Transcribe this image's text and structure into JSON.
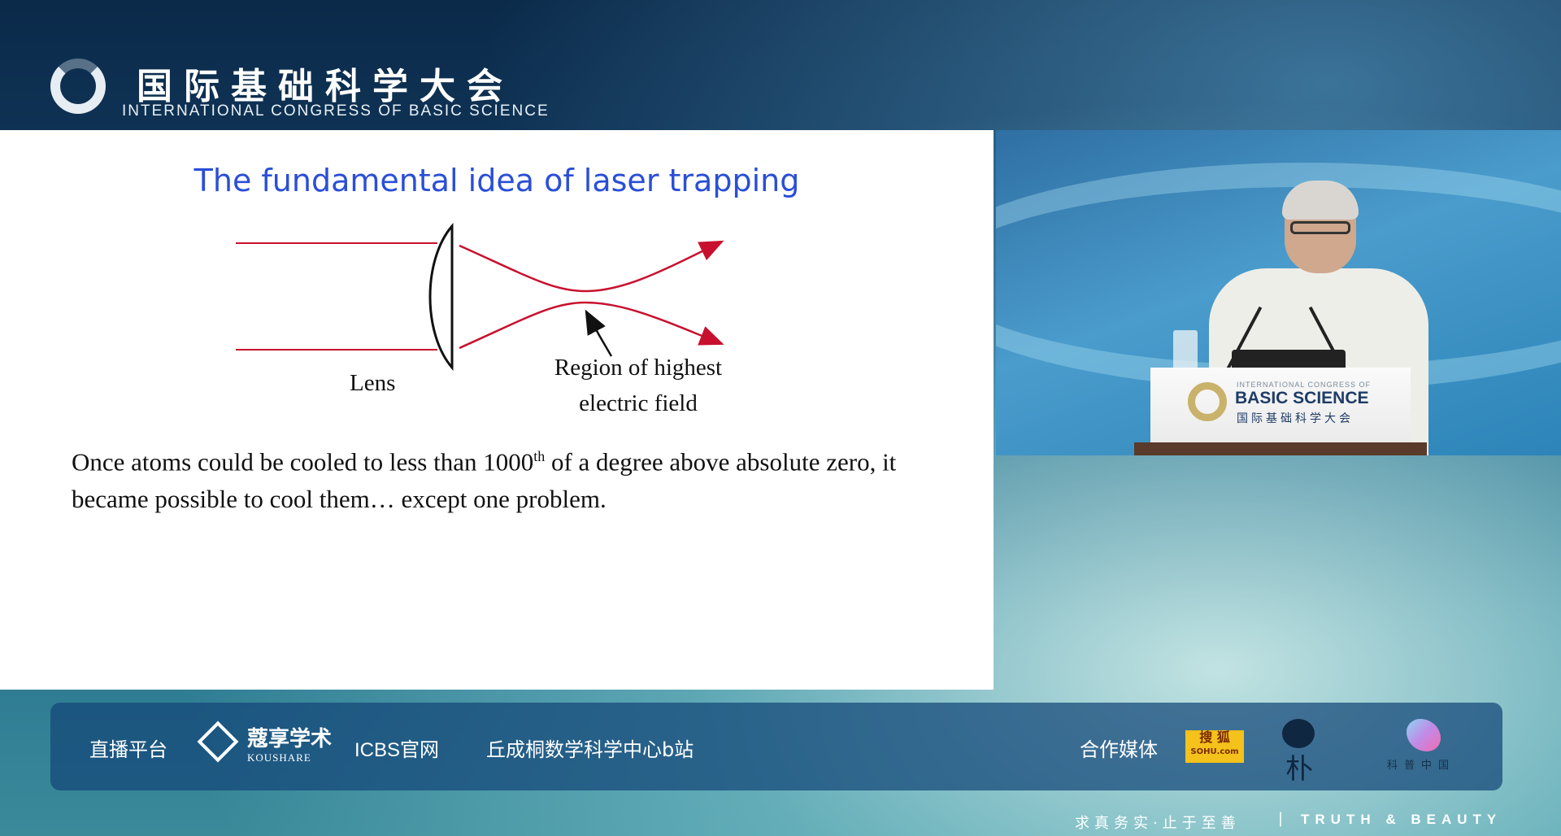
{
  "header": {
    "title_cn": "国际基础科学大会",
    "title_en": "INTERNATIONAL CONGRESS OF BASIC SCIENCE"
  },
  "slide": {
    "title": "The fundamental idea of laser trapping",
    "lens_label": "Lens",
    "region_label_line1": "Region of highest",
    "region_label_line2": "electric field",
    "body_part1": "Once atoms could be cooled to less than 1000",
    "body_sup": "th",
    "body_part2": " of a degree above absolute zero, it became possible to cool them… except one problem."
  },
  "podium": {
    "line1": "INTERNATIONAL CONGRESS OF",
    "line2": "BASIC SCIENCE",
    "line3": "国际基础科学大会"
  },
  "sponsor_bar": {
    "platform_label": "直播平台",
    "koushare_cn": "蔻享学术",
    "koushare_en": "KOUSHARE",
    "icbs_site": "ICBS官网",
    "bilibili": "丘成桐数学科学中心b站",
    "media_label": "合作媒体",
    "sohu_cn": "搜 狐",
    "sohu_en": "SOHU.com",
    "pu_char": "朴",
    "kepu_cn": "科普中国"
  },
  "footer": {
    "motto_cn": "求真务实·止于至善",
    "separator": "|",
    "motto_en": "TRUTH & BEAUTY"
  },
  "colors": {
    "slide_title": "#2a4fd6",
    "laser_beam": "#c8102e",
    "sohu_yellow": "#f4c21a"
  }
}
